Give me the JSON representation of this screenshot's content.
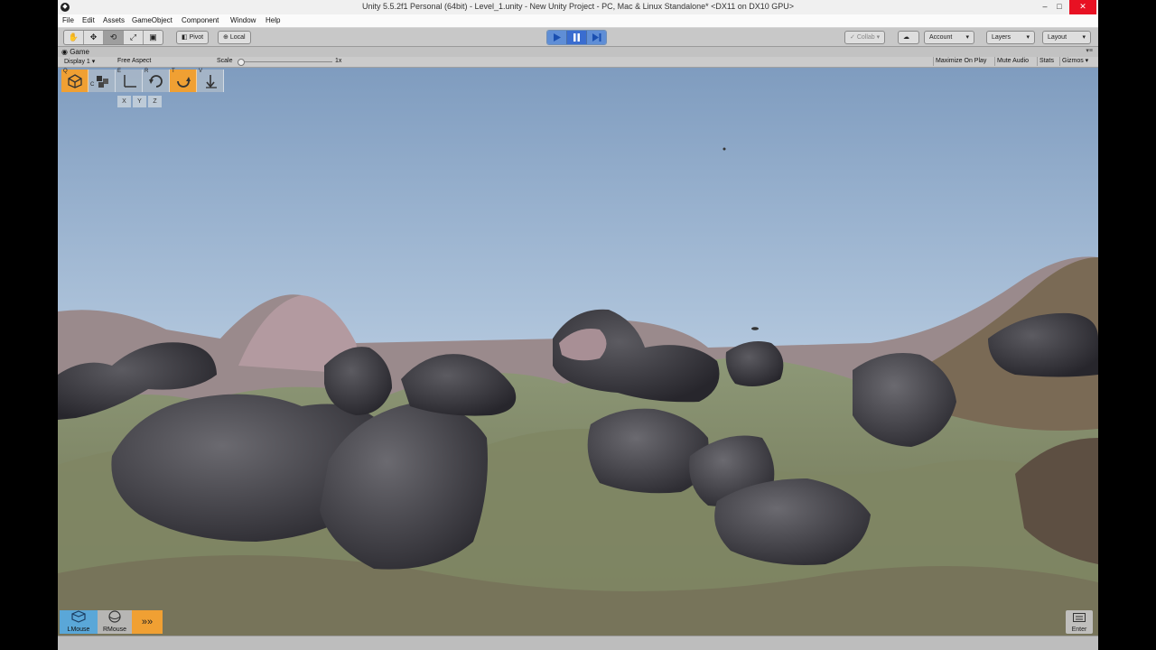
{
  "window": {
    "title": "Unity 5.5.2f1 Personal (64bit) - Level_1.unity - New Unity Project - PC, Mac & Linux Standalone* <DX11 on DX10 GPU>",
    "minimize": "–",
    "maximize": "□",
    "close": "✕"
  },
  "menu": [
    "File",
    "Edit",
    "Assets",
    "GameObject",
    "Component",
    "Window",
    "Help"
  ],
  "toolbar": {
    "pivot_label": "Pivot",
    "local_label": "Local",
    "collab_label": "Collab ▾",
    "account_label": "Account",
    "layers_label": "Layers",
    "layout_label": "Layout"
  },
  "game_view": {
    "tab_label": "Game",
    "display_label": "Display 1",
    "aspect_label": "Free Aspect",
    "scale_label": "Scale",
    "scale_value": "1x",
    "maximize_on_play": "Maximize On Play",
    "mute_audio": "Mute Audio",
    "stats": "Stats",
    "gizmos": "Gizmos"
  },
  "overlay": {
    "keys": [
      "Q",
      "C",
      "E",
      "R",
      "T",
      "V"
    ],
    "axes": [
      "X",
      "Y",
      "Z"
    ],
    "mouse_left": "LMouse",
    "mouse_right": "RMouse",
    "enter": "Enter"
  },
  "colors": {
    "sky_top": "#7f9cbf",
    "sky_bottom": "#e8eef3",
    "accent_orange": "#f0a033",
    "play_blue": "#5f8ed6"
  }
}
